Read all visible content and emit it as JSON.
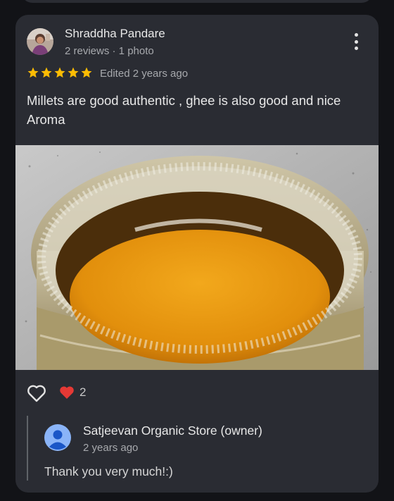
{
  "review": {
    "author_name": "Shraddha Pandare",
    "author_meta": "2 reviews · 1 photo",
    "rating": 5,
    "edited": "Edited 2 years ago",
    "text": "Millets are good authentic , ghee is also good and nice Aroma",
    "reaction_count": "2",
    "star_color": "#fbbc04",
    "reaction_color": "#e53935"
  },
  "owner_reply": {
    "name": "Satjeevan Organic Store (owner)",
    "time": "2 years ago",
    "text": "Thank you very much!:)"
  },
  "icons": {
    "more": "more-vert-icon",
    "like": "heart-outline-icon",
    "reaction": "red-heart-icon",
    "star": "star-icon"
  }
}
